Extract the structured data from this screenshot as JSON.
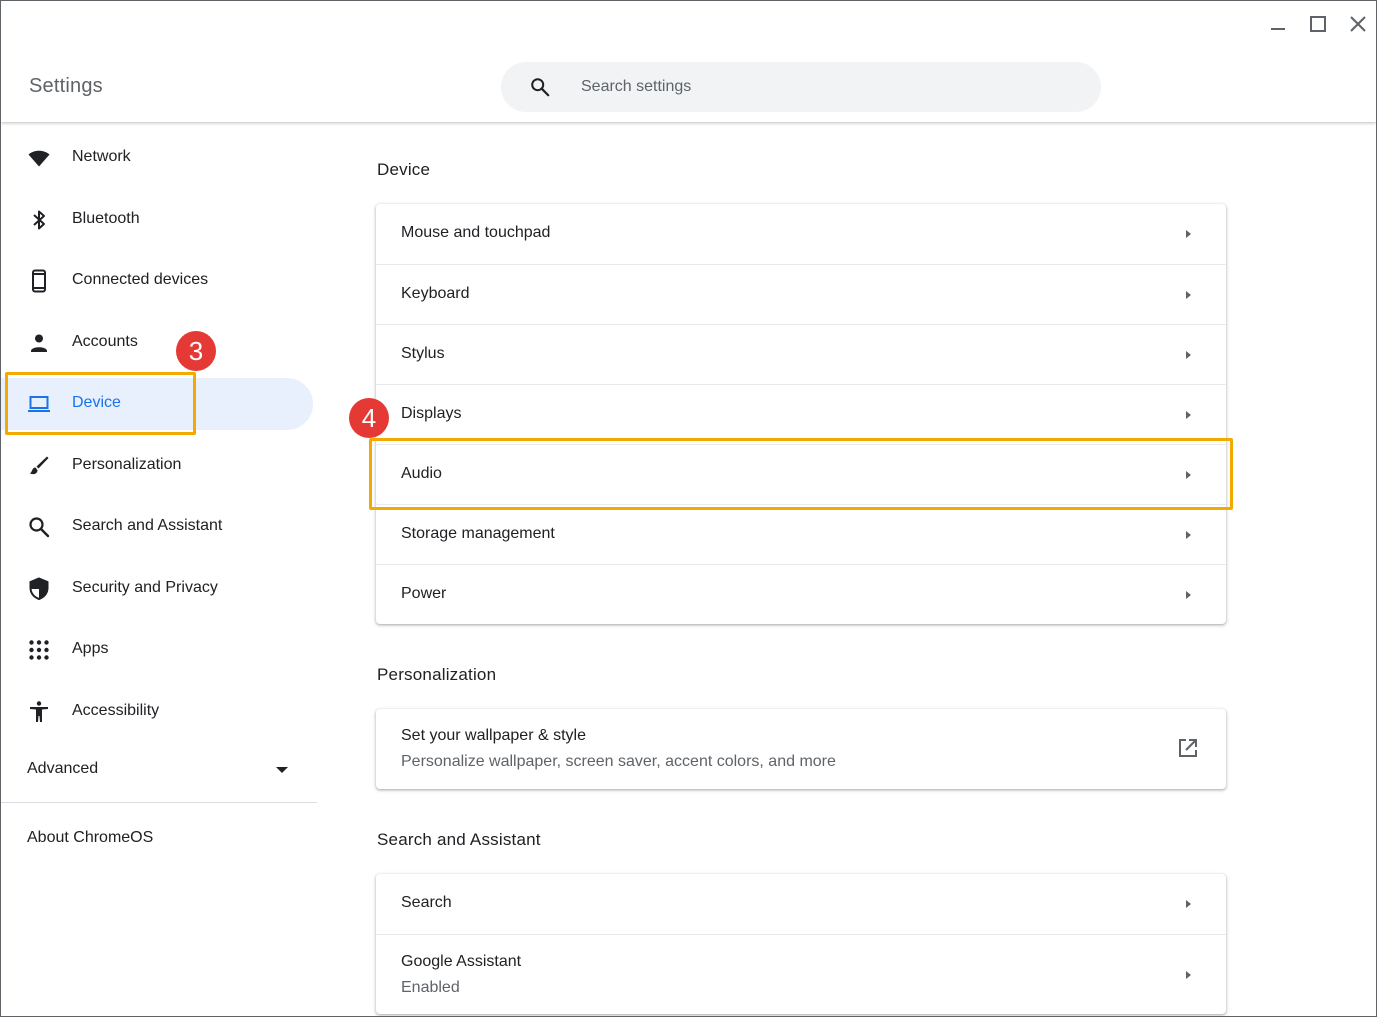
{
  "window": {
    "title": "Settings"
  },
  "search": {
    "placeholder": "Search settings"
  },
  "sidebar": {
    "items": [
      {
        "label": "Network",
        "icon": "wifi-icon"
      },
      {
        "label": "Bluetooth",
        "icon": "bluetooth-icon"
      },
      {
        "label": "Connected devices",
        "icon": "phone-icon"
      },
      {
        "label": "Accounts",
        "icon": "person-icon"
      },
      {
        "label": "Device",
        "icon": "laptop-icon",
        "active": true
      },
      {
        "label": "Personalization",
        "icon": "brush-icon"
      },
      {
        "label": "Search and Assistant",
        "icon": "search-icon"
      },
      {
        "label": "Security and Privacy",
        "icon": "shield-icon"
      },
      {
        "label": "Apps",
        "icon": "apps-grid-icon"
      },
      {
        "label": "Accessibility",
        "icon": "accessibility-icon"
      }
    ],
    "advanced_label": "Advanced",
    "about_label": "About ChromeOS"
  },
  "main": {
    "device": {
      "title": "Device",
      "rows": [
        "Mouse and touchpad",
        "Keyboard",
        "Stylus",
        "Displays",
        "Audio",
        "Storage management",
        "Power"
      ]
    },
    "personalization": {
      "title": "Personalization",
      "wallpaper_label": "Set your wallpaper & style",
      "wallpaper_sub": "Personalize wallpaper, screen saver, accent colors, and more"
    },
    "search_assistant": {
      "title": "Search and Assistant",
      "search_label": "Search",
      "assistant_label": "Google Assistant",
      "assistant_sub": "Enabled"
    }
  },
  "annotations": {
    "step3": "3",
    "step4": "4",
    "highlight_color": "#f2a900",
    "badge_color": "#e53935"
  },
  "colors": {
    "accent": "#1a73e8",
    "active_bg": "#e8f0fe"
  }
}
